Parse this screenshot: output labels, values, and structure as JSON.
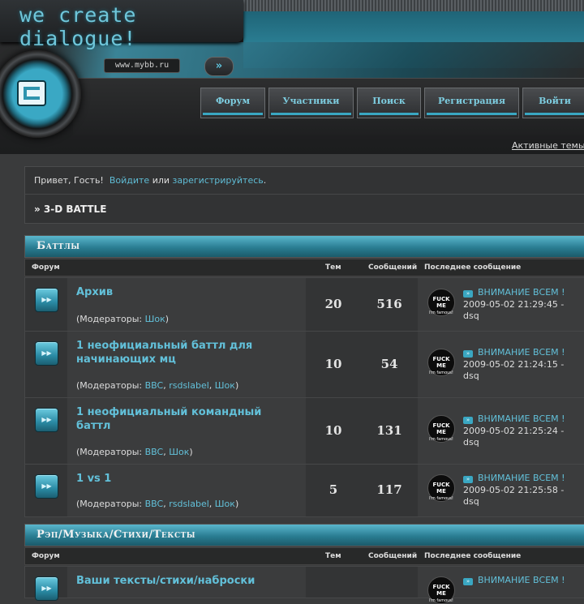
{
  "header": {
    "slogan": "we create dialogue!",
    "site_url": "www.mybb.ru",
    "url_arrow": "»",
    "nav": [
      "Форум",
      "Участники",
      "Поиск",
      "Регистрация",
      "Войти"
    ],
    "active_topics": "Активные темы"
  },
  "welcome": {
    "greeting": "Привет, Гость!",
    "login": "Войдите",
    "or": "или",
    "register": "зарегистрируйтесь",
    "period": ".",
    "breadcrumb": "» 3-D BATTLE"
  },
  "columns": {
    "forum": "Форум",
    "topics": "Тем",
    "posts": "Сообщений",
    "last": "Последнее сообщение"
  },
  "categories": [
    {
      "title": "Баттлы",
      "forums": [
        {
          "name": "Архив",
          "mods_prefix": "(Модераторы:",
          "mods": [
            "Шок"
          ],
          "mods_suffix": ")",
          "topics": "20",
          "posts": "516",
          "last_title": "ВНИМАНИЕ ВСЕМ !",
          "last_date": "2009-05-02 21:29:45 -",
          "last_user": "dsq"
        },
        {
          "name": "1 неофициальный баттл для начинающих мц",
          "mods_prefix": "(Модераторы:",
          "mods": [
            "BBC",
            "rsdslabel",
            "Шок"
          ],
          "mods_suffix": ")",
          "topics": "10",
          "posts": "54",
          "last_title": "ВНИМАНИЕ ВСЕМ !",
          "last_date": "2009-05-02 21:24:15 -",
          "last_user": "dsq"
        },
        {
          "name": "1 неофициальный командный баттл",
          "mods_prefix": "(Модераторы:",
          "mods": [
            "BBC",
            "Шок"
          ],
          "mods_suffix": ")",
          "topics": "10",
          "posts": "131",
          "last_title": "ВНИМАНИЕ ВСЕМ !",
          "last_date": "2009-05-02 21:25:24 -",
          "last_user": "dsq"
        },
        {
          "name": "1 vs 1",
          "mods_prefix": "(Модераторы:",
          "mods": [
            "BBC",
            "rsdslabel",
            "Шок"
          ],
          "mods_suffix": ")",
          "topics": "5",
          "posts": "117",
          "last_title": "ВНИМАНИЕ ВСЕМ !",
          "last_date": "2009-05-02 21:25:58 -",
          "last_user": "dsq"
        }
      ]
    },
    {
      "title": "Рэп/Музыка/Стихи/Тексты",
      "forums": [
        {
          "name": "Ваши тексты/стихи/наброски",
          "last_title": "ВНИМАНИЕ ВСЕМ !"
        }
      ]
    }
  ],
  "avatar": {
    "line1": "FUCK ME",
    "line2": "I'm famous!"
  },
  "colors": {
    "accent": "#62c0d9",
    "header_teal": "#2a7d92",
    "background": "#3a3b3c"
  },
  "icons": {
    "forum_icon": "forum-arrow-icon",
    "last_post_icon": "double-chevron-icon"
  }
}
